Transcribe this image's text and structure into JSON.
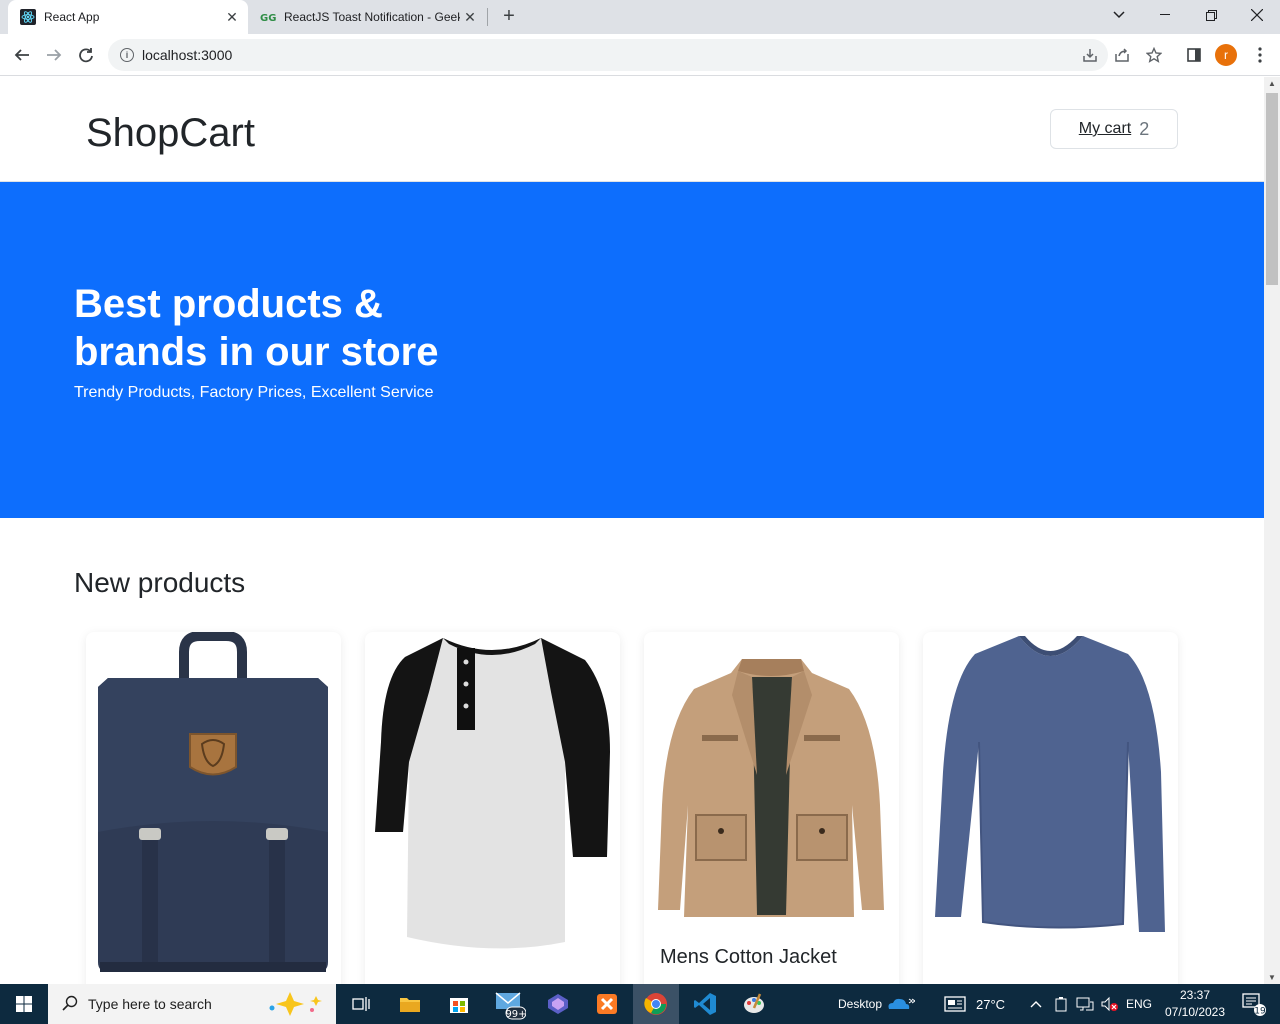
{
  "browser": {
    "tabs": [
      {
        "label": "React App",
        "icon": "react-icon",
        "active": true
      },
      {
        "label": "ReactJS Toast Notification - Geek",
        "icon": "geeksforgeeks-icon",
        "active": false
      }
    ],
    "url": "localhost:3000",
    "profile_initial": "r"
  },
  "page": {
    "brand": "ShopCart",
    "cart": {
      "label": "My cart",
      "count": "2"
    },
    "hero": {
      "title": "Best products & brands in our store",
      "subtitle": "Trendy Products, Factory Prices, Excellent Service"
    },
    "section_title": "New products",
    "products": [
      {
        "name": "",
        "image": "backpack"
      },
      {
        "name": "",
        "image": "raglan-tshirt"
      },
      {
        "name": "Mens Cotton Jacket",
        "image": "jacket"
      },
      {
        "name": "",
        "image": "longsleeve-shirt"
      }
    ]
  },
  "taskbar": {
    "search_placeholder": "Type here to search",
    "notification_badge": "99+",
    "desktop_label": "Desktop",
    "weather": "27°C",
    "language": "ENG",
    "time": "23:37",
    "date": "07/10/2023",
    "notification_count": "19"
  }
}
